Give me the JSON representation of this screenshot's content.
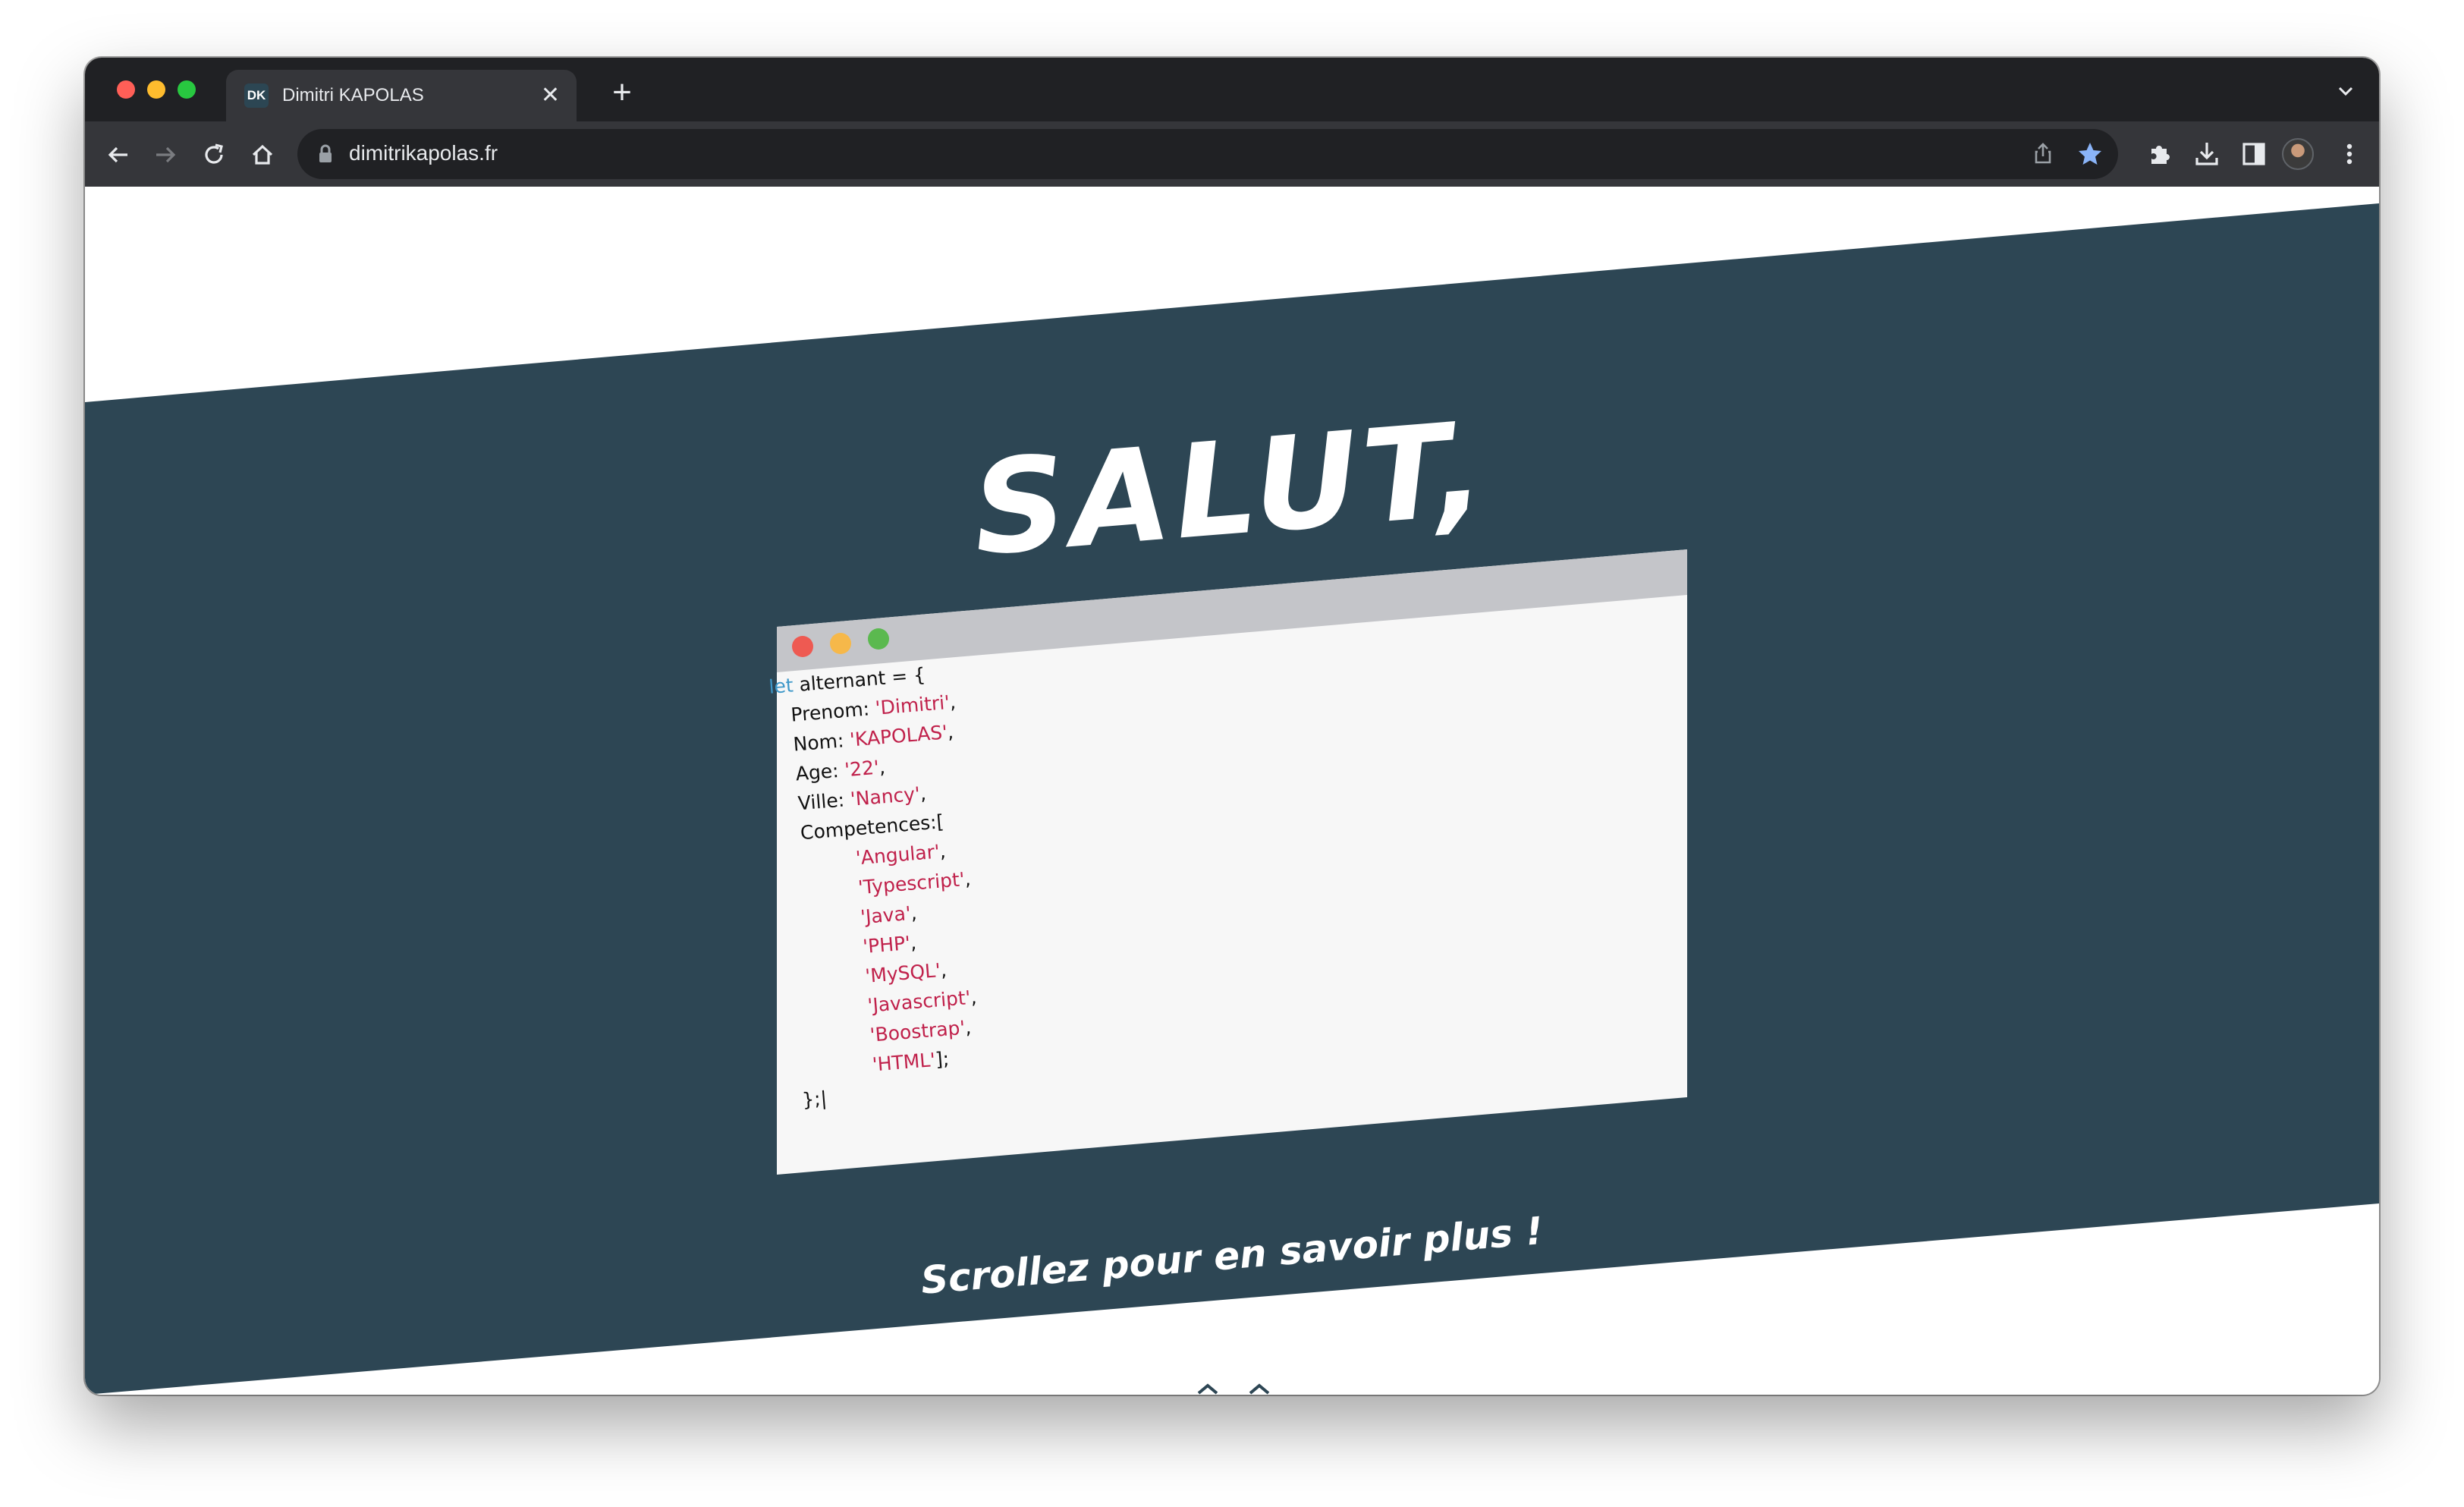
{
  "browser": {
    "tab": {
      "favicon_text": "DK",
      "title": "Dimitri KAPOLAS",
      "close_symbol": "✕"
    },
    "new_tab_symbol": "+",
    "url": "dimitrikapolas.fr",
    "icons": {
      "back": "arrow-left-icon",
      "forward": "arrow-right-icon",
      "reload": "reload-icon",
      "home": "home-icon",
      "lock": "lock-icon",
      "share": "share-icon",
      "bookmark": "star-icon",
      "extensions": "puzzle-icon",
      "downloads": "download-icon",
      "side_panel": "side-panel-icon",
      "menu": "kebab-menu-icon",
      "tab_list": "chevron-down-icon"
    },
    "colors": {
      "frame": "#202124",
      "toolbar": "#35363a",
      "bookmark_star": "#8ab4f8"
    }
  },
  "hero": {
    "title": "SALUT,",
    "background_color": "#2d4654",
    "code": {
      "line1_kw": "let",
      "line1_rest": " alternant = {",
      "prenom_key": "Prenom: ",
      "prenom_val": "'Dimitri'",
      "nom_key": "Nom: ",
      "nom_val": "'KAPOLAS'",
      "age_key": "Age: ",
      "age_val": "'22'",
      "ville_key": "Ville: ",
      "ville_val": "'Nancy'",
      "competences_key": "Competences:[",
      "skills": [
        "'Angular'",
        "'Typescript'",
        "'Java'",
        "'PHP'",
        "'MySQL'",
        "'Javascript'",
        "'Boostrap'",
        "'HTML'"
      ],
      "close": "};|"
    },
    "window_dots": {
      "red": "#ee5a52",
      "yellow": "#f6b84a",
      "green": "#5bb94f"
    },
    "scroll_hint": "Scrollez pour en savoir plus !"
  }
}
